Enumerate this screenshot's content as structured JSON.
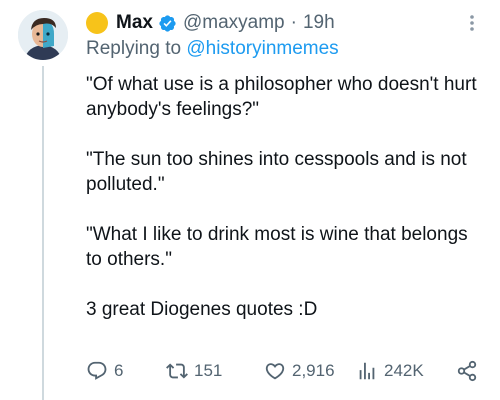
{
  "author": {
    "name": "Max",
    "handle": "@maxyamp",
    "separator": "·",
    "time": "19h"
  },
  "reply": {
    "prefix": "Replying to ",
    "target": "@historyinmemes"
  },
  "body": {
    "paragraphs": [
      "\"Of what use is a philosopher who doesn't hurt anybody's feelings?\"",
      "\"The sun too shines into cesspools and is not polluted.\"",
      "\"What I like to drink most is wine that belongs to others.\"",
      "3 great Diogenes quotes :D"
    ]
  },
  "actions": {
    "replies": "6",
    "reposts": "151",
    "likes": "2,916",
    "views": "242K"
  },
  "icons": {
    "avatar": "avatar-illustration",
    "status": "yellow-circle-emoji",
    "verified": "verified-badge-icon",
    "more": "more-options-icon",
    "reply": "reply-icon",
    "repost": "repost-icon",
    "like": "heart-icon",
    "views": "views-icon",
    "share": "share-icon"
  },
  "colors": {
    "text": "#0f1419",
    "muted": "#536471",
    "link": "#1d9bf0",
    "verified": "#1d9bf0",
    "status": "#f7c31a",
    "thread_line": "#cfd9de"
  }
}
